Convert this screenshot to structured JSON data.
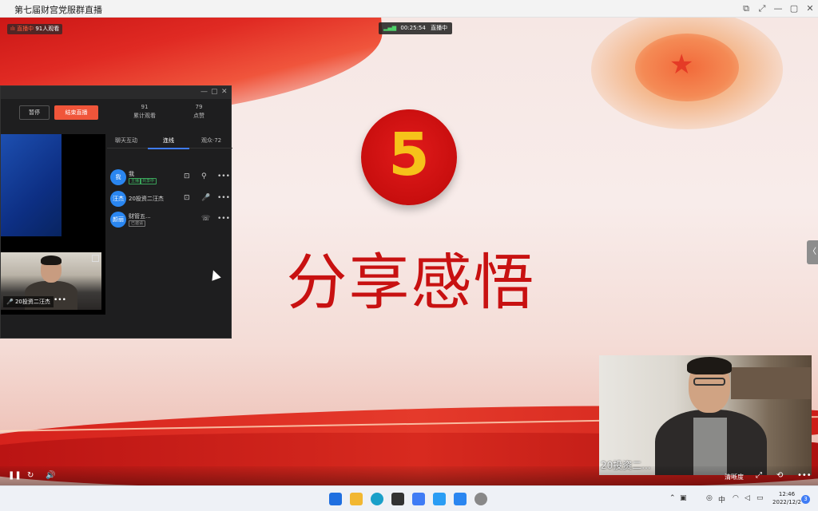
{
  "window": {
    "title": "第七届财宫党服群直播"
  },
  "live": {
    "status": "直播中",
    "viewers": "91人观看",
    "duration": "00:25:54",
    "state": "直播中"
  },
  "slide": {
    "number": "5",
    "heading": "分享感悟"
  },
  "panel": {
    "pause_label": "暂停",
    "end_label": "结束直播",
    "stats": [
      {
        "value": "91",
        "label": "累计观看"
      },
      {
        "value": "79",
        "label": "点赞"
      }
    ],
    "tabs": [
      "聊天互动",
      "连线",
      "观众·72"
    ],
    "members": [
      {
        "avatar": "我",
        "name": "我",
        "tags": [
          "主播",
          "共享中"
        ]
      },
      {
        "avatar": "汪杰",
        "name": "20投资二汪杰",
        "tags": []
      },
      {
        "avatar": "颜丽",
        "name": "财管五...",
        "tags": [
          "已邀请"
        ]
      }
    ],
    "cam_caption": "20投资二汪杰"
  },
  "pip": {
    "label": "20投资二..."
  },
  "controls": {
    "quality": "清晰度"
  },
  "taskbar": {
    "ime": "中",
    "time": "12:46",
    "date": "2022/12/2",
    "notifications": "3"
  },
  "colors": {
    "accent": "#f0553a",
    "slide_red": "#c81111",
    "number_gold": "#f6c21a",
    "tab_active": "#3f7cf5"
  }
}
